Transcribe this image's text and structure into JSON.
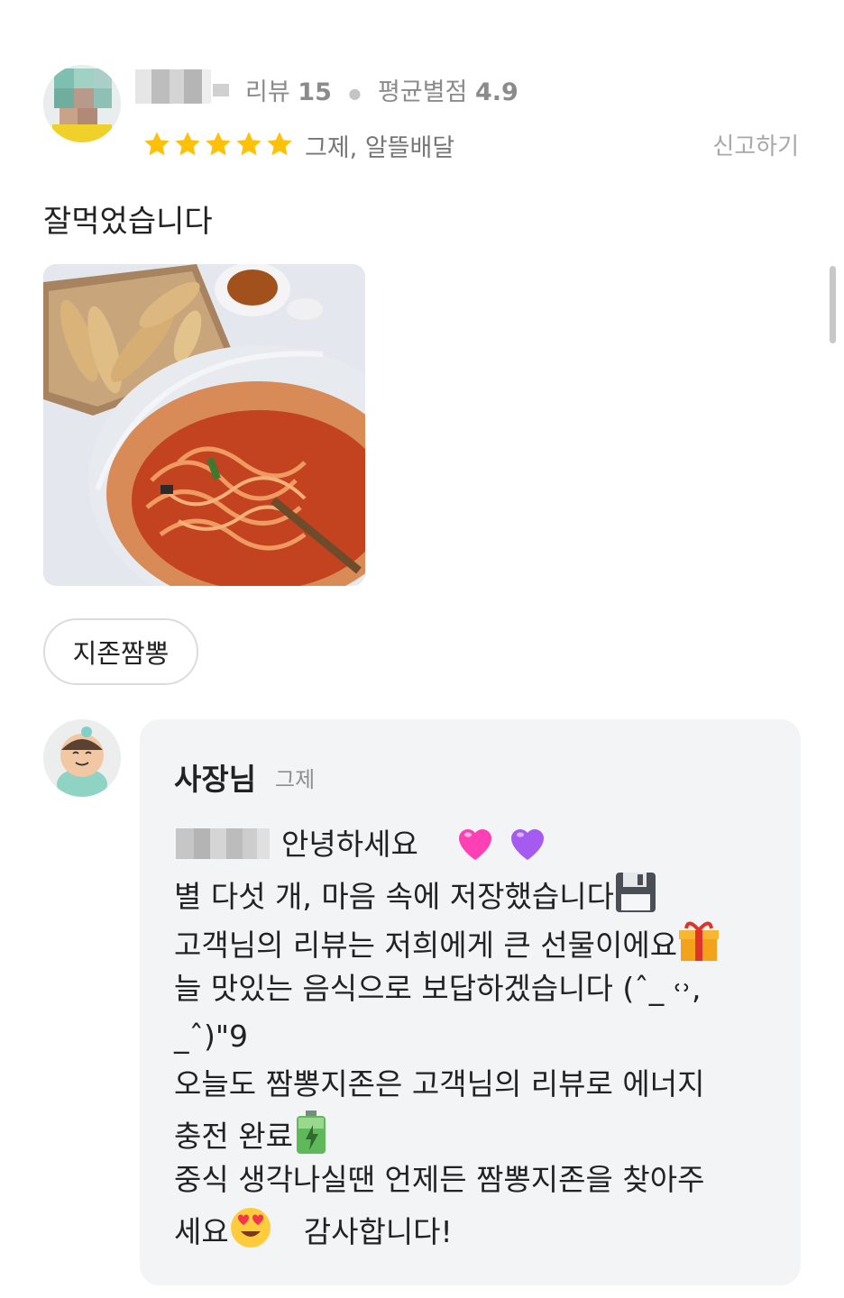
{
  "review": {
    "meta": {
      "review_label": "리뷰",
      "review_count": "15",
      "avg_label": "평균별점",
      "avg_rating": "4.9"
    },
    "rating": 5,
    "tags": "그제, 알뜰배달",
    "report_label": "신고하기",
    "text": "잘먹었습니다",
    "menu_chip": "지존짬뽕"
  },
  "reply": {
    "owner_name": "사장님",
    "time": "그제",
    "lines": [
      "안녕하세요",
      "별 다섯 개, 마음 속에 저장했습니다",
      "고객님의 리뷰는 저희에게 큰 선물이에요",
      "늘 맛있는 음식으로 보답하겠습니다 (ˆ_ ˓˒,",
      "_ˆ)\"9",
      "오늘도 짬뽕지존은 고객님의 리뷰로 에너지",
      "충전 완료",
      "중식 생각나실땐 언제든 짬뽕지존을 찾아주",
      "세요",
      "감사합니다!"
    ],
    "emoji_icons": [
      "pink-heart-icon",
      "purple-heart-icon",
      "floppy-disk-icon",
      "gift-icon",
      "battery-icon",
      "heart-eyes-icon"
    ]
  },
  "colors": {
    "star": "#FFC107",
    "reply_bg": "#F3F4F6",
    "meta_gray": "#8B8B8B"
  }
}
